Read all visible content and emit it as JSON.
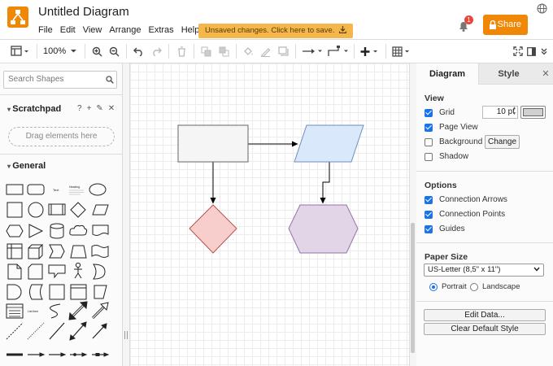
{
  "header": {
    "title": "Untitled Diagram",
    "menu": [
      "File",
      "Edit",
      "View",
      "Arrange",
      "Extras",
      "Help"
    ],
    "unsaved_notice": "Unsaved changes. Click here to save.",
    "notification_count": "1",
    "share_label": "Share",
    "accent_color": "#f08705"
  },
  "toolbar": {
    "zoom": "100%",
    "icons": [
      "format-panel-icon",
      "zoom-in-icon",
      "zoom-out-icon",
      "undo-icon",
      "redo-icon",
      "delete-icon",
      "to-front-icon",
      "to-back-icon",
      "fill-color-icon",
      "line-color-icon",
      "shadow-icon",
      "connection-icon",
      "waypoints-icon",
      "insert-icon",
      "table-icon",
      "fullscreen-icon",
      "format-icon",
      "collapse-icon"
    ]
  },
  "left_panel": {
    "search_placeholder": "Search Shapes",
    "scratchpad_title": "Scratchpad",
    "scratchpad_tools": [
      "?",
      "+",
      "✎",
      "✕"
    ],
    "scratchpad_drop": "Drag elements here",
    "general_title": "General"
  },
  "right_panel": {
    "tabs": [
      "Diagram",
      "Style"
    ],
    "view": {
      "heading": "View",
      "grid": {
        "label": "Grid",
        "checked": true,
        "size": "10 pt"
      },
      "page_view": {
        "label": "Page View",
        "checked": true
      },
      "background": {
        "label": "Background",
        "checked": false,
        "button": "Change"
      },
      "shadow": {
        "label": "Shadow",
        "checked": false
      }
    },
    "options": {
      "heading": "Options",
      "items": [
        {
          "label": "Connection Arrows",
          "checked": true
        },
        {
          "label": "Connection Points",
          "checked": true
        },
        {
          "label": "Guides",
          "checked": true
        }
      ]
    },
    "paper": {
      "heading": "Paper Size",
      "selected": "US-Letter (8,5\" x 11\")",
      "portrait": "Portrait",
      "landscape": "Landscape",
      "orientation": "portrait"
    },
    "buttons": {
      "edit_data": "Edit Data...",
      "clear_style": "Clear Default Style"
    }
  },
  "diagram": {
    "shapes": [
      {
        "type": "rectangle",
        "fill": "#f5f5f5",
        "stroke": "#666666"
      },
      {
        "type": "parallelogram",
        "fill": "#dae8fc",
        "stroke": "#6c8ebf"
      },
      {
        "type": "rhombus",
        "fill": "#f8cecc",
        "stroke": "#b85450"
      },
      {
        "type": "hexagon",
        "fill": "#e1d5e7",
        "stroke": "#9673a6"
      }
    ],
    "connectors": [
      "rectangle-to-parallelogram",
      "rectangle-to-rhombus",
      "parallelogram-to-hexagon"
    ]
  }
}
